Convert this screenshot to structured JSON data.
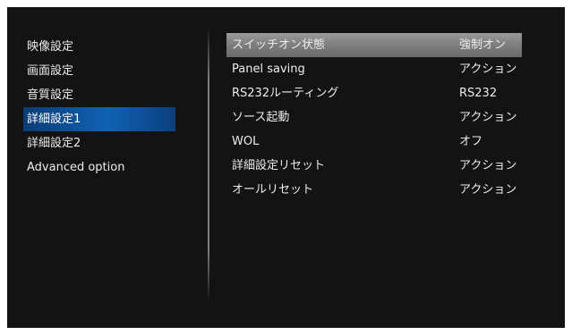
{
  "left_menu": {
    "items": [
      {
        "label": "映像設定",
        "active": false
      },
      {
        "label": "画面設定",
        "active": false
      },
      {
        "label": "音質設定",
        "active": false
      },
      {
        "label": "詳細設定1",
        "active": true
      },
      {
        "label": "詳細設定2",
        "active": false
      },
      {
        "label": "Advanced option",
        "active": false
      }
    ]
  },
  "settings": {
    "rows": [
      {
        "label": "スイッチオン状態",
        "value": "強制オン",
        "selected": true
      },
      {
        "label": "Panel saving",
        "value": "アクション",
        "selected": false
      },
      {
        "label": "RS232ルーティング",
        "value": "RS232",
        "selected": false
      },
      {
        "label": "ソース起動",
        "value": "アクション",
        "selected": false
      },
      {
        "label": "WOL",
        "value": "オフ",
        "selected": false
      },
      {
        "label": "詳細設定リセット",
        "value": "アクション",
        "selected": false
      },
      {
        "label": "オールリセット",
        "value": "アクション",
        "selected": false
      }
    ]
  },
  "colors": {
    "background": "#131313",
    "active_menu": "#1062b4",
    "selected_row": "#8a8a8a",
    "text": "#ececec"
  }
}
